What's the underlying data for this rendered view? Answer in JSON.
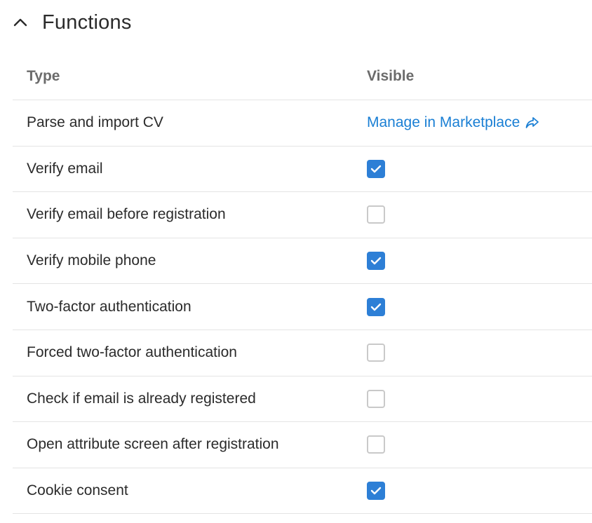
{
  "section": {
    "title": "Functions",
    "collapse_icon": "chevron-up-icon"
  },
  "table": {
    "columns": {
      "type": "Type",
      "visible": "Visible"
    },
    "link": {
      "label": "Manage in Marketplace",
      "icon": "share-icon"
    },
    "rows": [
      {
        "label": "Parse and import CV",
        "visible": "link"
      },
      {
        "label": "Verify email",
        "visible": true
      },
      {
        "label": "Verify email before registration",
        "visible": false
      },
      {
        "label": "Verify mobile phone",
        "visible": true
      },
      {
        "label": "Two-factor authentication",
        "visible": true
      },
      {
        "label": "Forced two-factor authentication",
        "visible": false
      },
      {
        "label": "Check if email is already registered",
        "visible": false
      },
      {
        "label": "Open attribute screen after registration",
        "visible": false
      },
      {
        "label": "Cookie consent",
        "visible": true
      }
    ]
  },
  "colors": {
    "accent": "#2d7fd6",
    "link": "#1a7fd4",
    "text": "#2b2b2b",
    "header_text": "#6b6b6b",
    "divider": "#e4e4e4"
  }
}
